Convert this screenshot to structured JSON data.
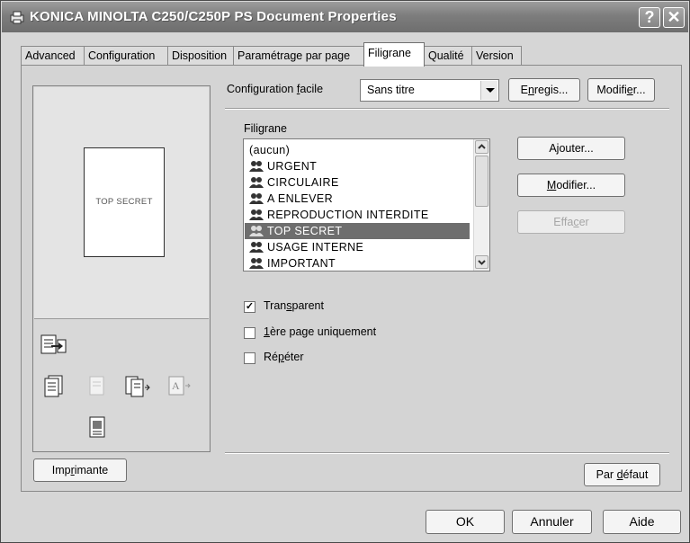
{
  "window": {
    "title": "KONICA MINOLTA C250/C250P PS Document Properties",
    "help_label": "?",
    "close_label": "✕"
  },
  "tabs": [
    {
      "label": "Advanced"
    },
    {
      "label": "Configuration"
    },
    {
      "label": "Disposition"
    },
    {
      "label": "Paramétrage par page"
    },
    {
      "label": "Filigrane"
    },
    {
      "label": "Qualité"
    },
    {
      "label": "Version"
    }
  ],
  "active_tab": "Filigrane",
  "preview": {
    "page_text": "TOP SECRET",
    "icons": [
      "document-arrow-icon",
      "duplex-icon",
      "blank-page-icon",
      "booklet-icon",
      "text-page-icon",
      "poster-icon"
    ]
  },
  "easy_config": {
    "label_prefix": "Configuration ",
    "label_underlined": "f",
    "label_suffix": "acile",
    "selected_value": "Sans titre",
    "save_prefix": "E",
    "save_underlined": "n",
    "save_suffix": "regis...",
    "modify_prefix": "Modifi",
    "modify_underlined": "e",
    "modify_suffix": "r..."
  },
  "watermark": {
    "group_label": "Filigrane",
    "items": [
      {
        "label": "(aucun)",
        "icon": false
      },
      {
        "label": "URGENT",
        "icon": true
      },
      {
        "label": "CIRCULAIRE",
        "icon": true
      },
      {
        "label": "A ENLEVER",
        "icon": true
      },
      {
        "label": "REPRODUCTION INTERDITE",
        "icon": true
      },
      {
        "label": "TOP SECRET",
        "icon": true
      },
      {
        "label": "USAGE INTERNE",
        "icon": true
      },
      {
        "label": "IMPORTANT",
        "icon": true
      }
    ],
    "selected": "TOP SECRET",
    "add_label": "Ajouter...",
    "modify_prefix": "",
    "modify_underlined": "M",
    "modify_suffix": "odifier...",
    "delete_prefix": "Effa",
    "delete_underlined": "c",
    "delete_suffix": "er"
  },
  "options": {
    "transparent": {
      "prefix": "Tran",
      "underlined": "s",
      "suffix": "parent",
      "checked": true
    },
    "first_page": {
      "prefix": "",
      "underlined": "1",
      "suffix": "ère page uniquement",
      "checked": false
    },
    "repeat": {
      "prefix": "Ré",
      "underlined": "p",
      "suffix": "éter",
      "checked": false
    }
  },
  "buttons": {
    "printer_prefix": "Imp",
    "printer_underlined": "r",
    "printer_suffix": "imante",
    "default_prefix": "Par ",
    "default_underlined": "d",
    "default_suffix": "éfaut",
    "ok": "OK",
    "cancel": "Annuler",
    "help": "Aide"
  }
}
